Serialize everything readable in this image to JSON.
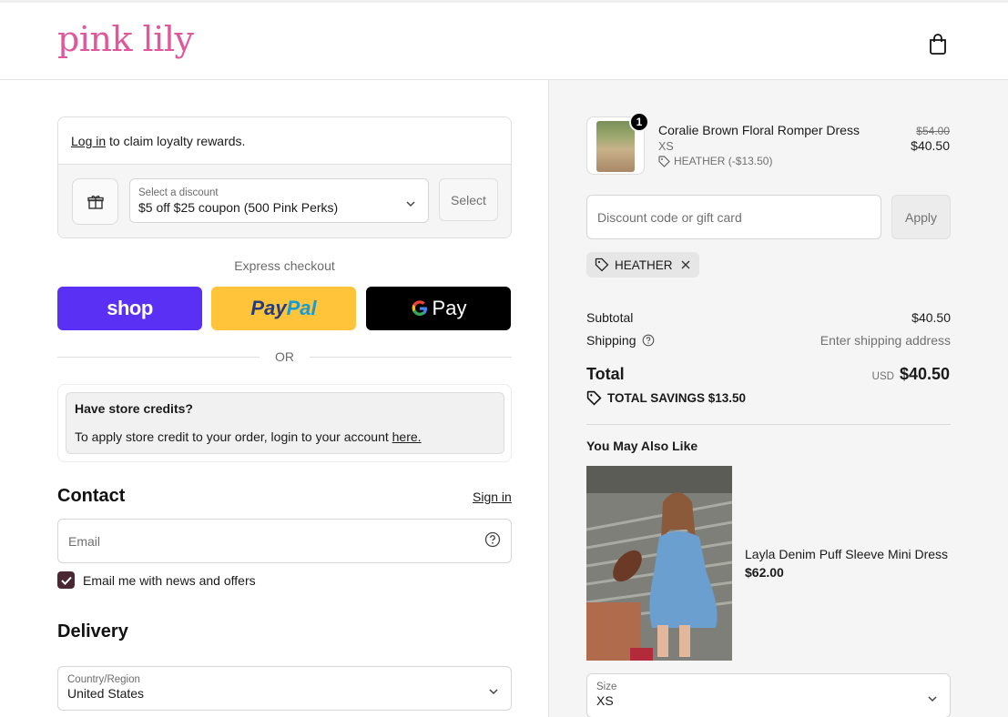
{
  "brand": {
    "logo": "pink lily",
    "color": "#e0579b"
  },
  "loyalty": {
    "login_link": "Log in",
    "login_text": " to claim loyalty rewards.",
    "discount_label": "Select a discount",
    "discount_value": "$5 off $25 coupon (500 Pink Perks)",
    "select_button": "Select"
  },
  "express": {
    "title": "Express checkout",
    "shop": "shop",
    "paypal_1": "Pay",
    "paypal_2": "Pal",
    "gpay": "Pay",
    "or": "OR"
  },
  "credits": {
    "title": "Have store credits?",
    "text": "To apply store credit to your order, login to your account ",
    "link": "here."
  },
  "contact": {
    "heading": "Contact",
    "signin": "Sign in",
    "email_placeholder": "Email",
    "newsletter": "Email me with news and offers",
    "newsletter_checked": true
  },
  "delivery": {
    "heading": "Delivery",
    "country_label": "Country/Region",
    "country_value": "United States"
  },
  "cart": {
    "item": {
      "name": "Coralie Brown Floral Romper Dress",
      "size": "XS",
      "discount": "HEATHER (-$13.50)",
      "old_price": "$54.00",
      "price": "$40.50",
      "quantity": "1"
    },
    "code_placeholder": "Discount code or gift card",
    "apply_button": "Apply",
    "applied_code": "HEATHER",
    "subtotal_label": "Subtotal",
    "subtotal_value": "$40.50",
    "shipping_label": "Shipping",
    "shipping_value": "Enter shipping address",
    "total_label": "Total",
    "currency": "USD",
    "total_value": "$40.50",
    "savings": "TOTAL SAVINGS  $13.50"
  },
  "recommend": {
    "heading": "You May Also Like",
    "name": "Layla Denim Puff Sleeve Mini Dress",
    "price": "$62.00",
    "size_label": "Size",
    "size_value": "XS"
  }
}
